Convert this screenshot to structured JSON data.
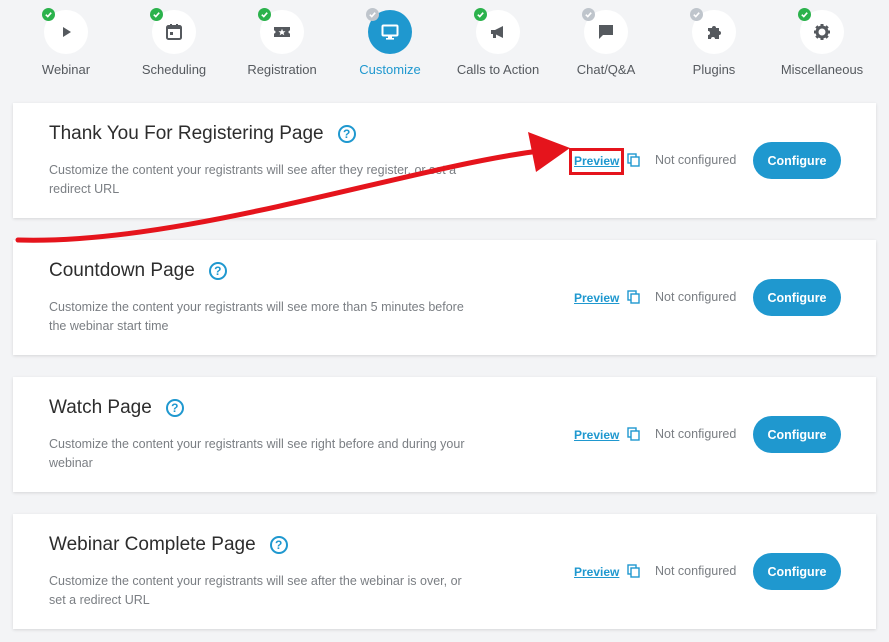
{
  "steps": [
    {
      "label": "Webinar",
      "icon": "play-icon",
      "state": "done"
    },
    {
      "label": "Scheduling",
      "icon": "calendar-icon",
      "state": "done"
    },
    {
      "label": "Registration",
      "icon": "ticket-icon",
      "state": "done"
    },
    {
      "label": "Customize",
      "icon": "monitor-icon",
      "state": "active"
    },
    {
      "label": "Calls to Action",
      "icon": "megaphone-icon",
      "state": "done"
    },
    {
      "label": "Chat/Q&A",
      "icon": "chat-icon",
      "state": "pending"
    },
    {
      "label": "Plugins",
      "icon": "puzzle-icon",
      "state": "pending"
    },
    {
      "label": "Miscellaneous",
      "icon": "gear-icon",
      "state": "done"
    }
  ],
  "colors": {
    "accent": "#1f98cf",
    "done": "#2bb24c",
    "pending": "#bfc5cc",
    "annotation": "#e5141c"
  },
  "cards": [
    {
      "title": "Thank You For Registering Page",
      "description": "Customize the content your registrants will see after they register, or set a redirect URL",
      "preview_label": "Preview",
      "status": "Not configured",
      "button_label": "Configure"
    },
    {
      "title": "Countdown Page",
      "description": "Customize the content your registrants will see more than 5 minutes before the webinar start time",
      "preview_label": "Preview",
      "status": "Not configured",
      "button_label": "Configure"
    },
    {
      "title": "Watch Page",
      "description": "Customize the content your registrants will see right before and during your webinar",
      "preview_label": "Preview",
      "status": "Not configured",
      "button_label": "Configure"
    },
    {
      "title": "Webinar Complete Page",
      "description": "Customize the content your registrants will see after the webinar is over, or set a redirect URL",
      "preview_label": "Preview",
      "status": "Not configured",
      "button_label": "Configure"
    }
  ]
}
